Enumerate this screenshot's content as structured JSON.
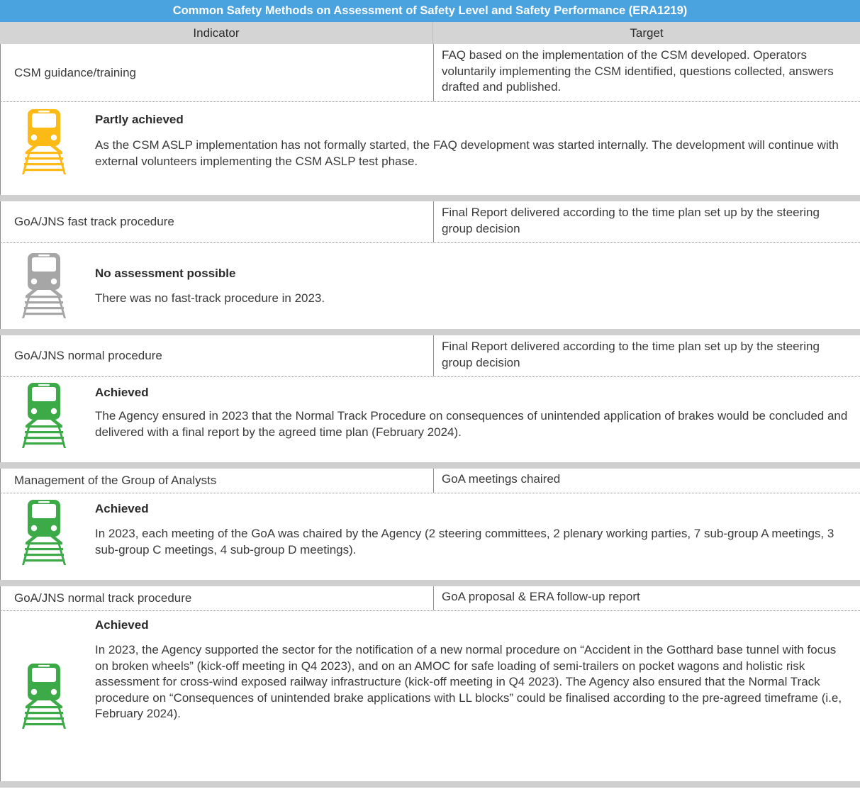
{
  "title": "Common Safety Methods on Assessment of Safety Level and Safety Performance (ERA1219)",
  "columns": {
    "indicator": "Indicator",
    "target": "Target"
  },
  "status_colors": {
    "partly_achieved": "#fbba16",
    "no_assessment": "#a6a6a6",
    "achieved": "#3daa48"
  },
  "rows": [
    {
      "indicator": "CSM guidance/training",
      "target": "FAQ based on the implementation of the CSM developed. Operators voluntarily implementing the CSM identified, questions collected, answers drafted and published.",
      "icon": "train-icon-yellow",
      "status": "Partly achieved",
      "detail": "As the CSM ASLP implementation has not formally started, the FAQ development was started internally. The development will continue with external volunteers implementing the CSM ASLP test phase."
    },
    {
      "indicator": "GoA/JNS fast track procedure",
      "target": "Final Report delivered according to the time plan set up by the steering group decision",
      "icon": "train-icon-grey",
      "status": "No assessment possible",
      "detail": "There was no fast-track procedure in 2023."
    },
    {
      "indicator": "GoA/JNS normal procedure",
      "target": "Final Report delivered according to the time plan set up by the steering group decision",
      "icon": "train-icon-green",
      "status": "Achieved",
      "detail": "The Agency ensured in 2023 that the Normal Track Procedure on consequences of unintended application of brakes would be concluded and delivered with a final report by the agreed time plan (February 2024)."
    },
    {
      "indicator": "Management of the Group of Analysts",
      "target": "GoA meetings chaired",
      "icon": "train-icon-green",
      "status": "Achieved",
      "detail": "In 2023, each meeting of the GoA was chaired by the Agency (2 steering committees, 2 plenary working parties, 7 sub-group A meetings, 3 sub-group C meetings, 4 sub-group D meetings)."
    },
    {
      "indicator": "GoA/JNS normal track procedure",
      "target": "GoA proposal & ERA follow-up report",
      "icon": "train-icon-green",
      "status": "Achieved",
      "detail": "In 2023, the Agency supported the sector for the notification of a new normal procedure on “Accident in the Gotthard base tunnel with focus on broken wheels” (kick-off meeting in Q4 2023), and on an AMOC for safe loading of semi-trailers on pocket wagons and holistic risk assessment for cross-wind exposed railway infrastructure (kick-off meeting in Q4 2023). The Agency also ensured that the Normal Track procedure on “Consequences of unintended brake applications with LL blocks” could be finalised according to the pre-agreed timeframe (i.e, February 2024)."
    }
  ]
}
